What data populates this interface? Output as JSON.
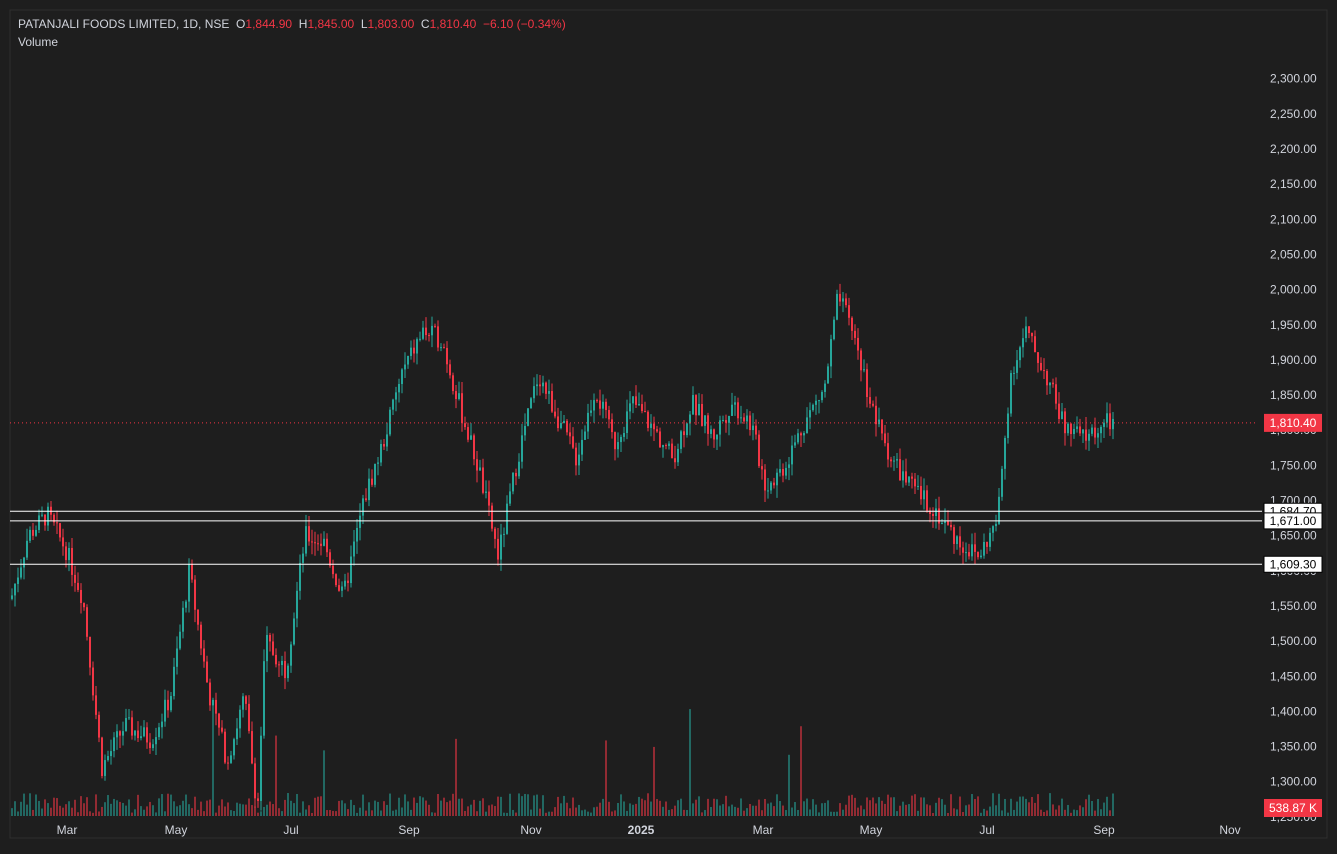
{
  "legend": {
    "symbol": "PATANJALI FOODS LIMITED, 1D, NSE",
    "o_label": "O",
    "o_value": "1,844.90",
    "h_label": "H",
    "h_value": "1,845.00",
    "l_label": "L",
    "l_value": "1,803.00",
    "c_label": "C",
    "c_value": "1,810.40",
    "change": "−6.10 (−0.34%)",
    "volume_label": "Volume"
  },
  "colors": {
    "up": "#26a69a",
    "down": "#f23645",
    "bg": "#1e1e1e",
    "grid": "#2a2a2a",
    "axis_text": "#d1d4dc",
    "line": "#ffffff"
  },
  "chart_data": {
    "type": "candlestick",
    "title": "PATANJALI FOODS LIMITED, 1D, NSE",
    "ylim": [
      1225,
      2325
    ],
    "y_ticks": [
      "2,300.00",
      "2,250.00",
      "2,200.00",
      "2,150.00",
      "2,100.00",
      "2,050.00",
      "2,000.00",
      "1,950.00",
      "1,900.00",
      "1,850.00",
      "1,800.00",
      "1,750.00",
      "1,700.00",
      "1,650.00",
      "1,600.00",
      "1,550.00",
      "1,500.00",
      "1,450.00",
      "1,400.00",
      "1,350.00",
      "1,300.00",
      "1,250.00"
    ],
    "x_ticks": [
      "Mar",
      "May",
      "Jul",
      "Sep",
      "Nov",
      "2025",
      "Mar",
      "May",
      "Jul",
      "Sep",
      "Nov"
    ],
    "last_price": 1810.4,
    "last_price_label": "1,810.40",
    "volume_last_label": "538.87 K",
    "horizontal_lines": [
      {
        "value": 1684.7,
        "label": "1,684.70"
      },
      {
        "value": 1671.0,
        "label": "1,671.00"
      },
      {
        "value": 1609.3,
        "label": "1,609.30"
      }
    ],
    "close_path": [
      {
        "x": "2024-02-01",
        "y": 1560
      },
      {
        "x": "2024-02-10",
        "y": 1650
      },
      {
        "x": "2024-02-20",
        "y": 1680
      },
      {
        "x": "2024-03-01",
        "y": 1630
      },
      {
        "x": "2024-03-10",
        "y": 1560
      },
      {
        "x": "2024-03-20",
        "y": 1320
      },
      {
        "x": "2024-04-01",
        "y": 1380
      },
      {
        "x": "2024-04-15",
        "y": 1360
      },
      {
        "x": "2024-04-25",
        "y": 1420
      },
      {
        "x": "2024-05-05",
        "y": 1600
      },
      {
        "x": "2024-05-15",
        "y": 1430
      },
      {
        "x": "2024-05-25",
        "y": 1330
      },
      {
        "x": "2024-06-03",
        "y": 1420
      },
      {
        "x": "2024-06-10",
        "y": 1260
      },
      {
        "x": "2024-06-14",
        "y": 1500
      },
      {
        "x": "2024-06-25",
        "y": 1460
      },
      {
        "x": "2024-07-05",
        "y": 1650
      },
      {
        "x": "2024-07-15",
        "y": 1640
      },
      {
        "x": "2024-07-25",
        "y": 1560
      },
      {
        "x": "2024-08-05",
        "y": 1700
      },
      {
        "x": "2024-08-15",
        "y": 1780
      },
      {
        "x": "2024-08-25",
        "y": 1880
      },
      {
        "x": "2024-09-05",
        "y": 1940
      },
      {
        "x": "2024-09-15",
        "y": 1930
      },
      {
        "x": "2024-09-25",
        "y": 1830
      },
      {
        "x": "2024-10-05",
        "y": 1740
      },
      {
        "x": "2024-10-15",
        "y": 1620
      },
      {
        "x": "2024-10-25",
        "y": 1760
      },
      {
        "x": "2024-11-05",
        "y": 1880
      },
      {
        "x": "2024-11-15",
        "y": 1820
      },
      {
        "x": "2024-11-25",
        "y": 1760
      },
      {
        "x": "2024-12-05",
        "y": 1860
      },
      {
        "x": "2024-12-15",
        "y": 1780
      },
      {
        "x": "2024-12-25",
        "y": 1840
      },
      {
        "x": "2025-01-05",
        "y": 1800
      },
      {
        "x": "2025-01-15",
        "y": 1760
      },
      {
        "x": "2025-01-25",
        "y": 1840
      },
      {
        "x": "2025-02-05",
        "y": 1790
      },
      {
        "x": "2025-02-15",
        "y": 1840
      },
      {
        "x": "2025-02-25",
        "y": 1810
      },
      {
        "x": "2025-03-05",
        "y": 1720
      },
      {
        "x": "2025-03-15",
        "y": 1750
      },
      {
        "x": "2025-03-25",
        "y": 1810
      },
      {
        "x": "2025-04-05",
        "y": 1860
      },
      {
        "x": "2025-04-12",
        "y": 1990
      },
      {
        "x": "2025-04-20",
        "y": 1940
      },
      {
        "x": "2025-05-01",
        "y": 1820
      },
      {
        "x": "2025-05-10",
        "y": 1760
      },
      {
        "x": "2025-05-20",
        "y": 1720
      },
      {
        "x": "2025-06-01",
        "y": 1690
      },
      {
        "x": "2025-06-15",
        "y": 1640
      },
      {
        "x": "2025-06-25",
        "y": 1620
      },
      {
        "x": "2025-07-05",
        "y": 1670
      },
      {
        "x": "2025-07-12",
        "y": 1880
      },
      {
        "x": "2025-07-20",
        "y": 1940
      },
      {
        "x": "2025-08-01",
        "y": 1870
      },
      {
        "x": "2025-08-10",
        "y": 1800
      },
      {
        "x": "2025-08-20",
        "y": 1790
      },
      {
        "x": "2025-09-01",
        "y": 1810
      }
    ]
  }
}
